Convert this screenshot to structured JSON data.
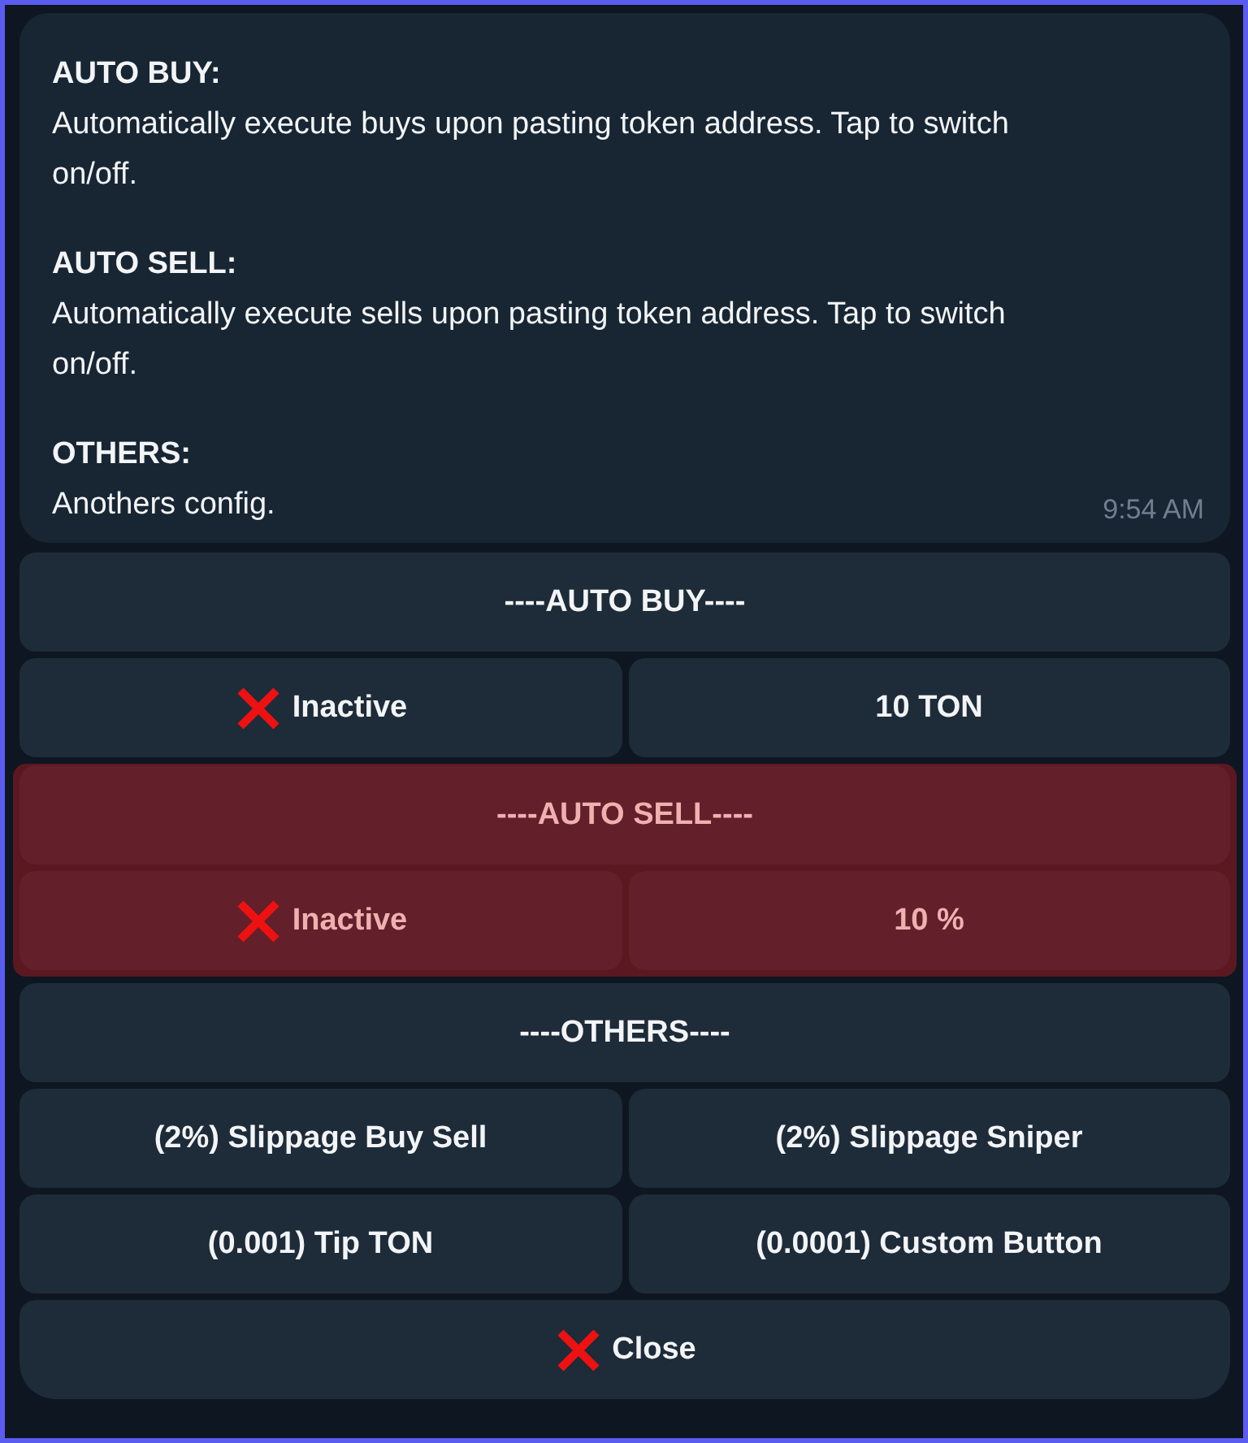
{
  "message": {
    "sections": [
      {
        "heading": "AUTO BUY:",
        "body": "Automatically execute buys upon pasting token address. Tap to switch on/off."
      },
      {
        "heading": "AUTO SELL:",
        "body": "Automatically execute sells upon pasting token address. Tap to switch on/off."
      },
      {
        "heading": "OTHERS:",
        "body": "Anothers config."
      }
    ],
    "time": "9:54 AM"
  },
  "keyboard": {
    "groups": [
      {
        "highlighted": false,
        "rows": [
          [
            {
              "label": "----AUTO BUY----",
              "kind": "plain"
            }
          ],
          [
            {
              "label": "Inactive",
              "kind": "cross"
            },
            {
              "label": "10 TON",
              "kind": "plain"
            }
          ]
        ]
      },
      {
        "highlighted": true,
        "rows": [
          [
            {
              "label": "----AUTO SELL----",
              "kind": "plain"
            }
          ],
          [
            {
              "label": "Inactive",
              "kind": "cross"
            },
            {
              "label": "10 %",
              "kind": "plain"
            }
          ]
        ]
      },
      {
        "highlighted": false,
        "rows": [
          [
            {
              "label": "----OTHERS----",
              "kind": "plain"
            }
          ],
          [
            {
              "label": "(2%) Slippage Buy Sell",
              "kind": "plain"
            },
            {
              "label": "(2%) Slippage Sniper",
              "kind": "plain"
            }
          ],
          [
            {
              "label": "(0.001) Tip TON",
              "kind": "plain"
            },
            {
              "label": "(0.0001) Custom Button",
              "kind": "plain"
            }
          ],
          [
            {
              "label": "Close",
              "kind": "cross"
            }
          ]
        ]
      }
    ]
  }
}
